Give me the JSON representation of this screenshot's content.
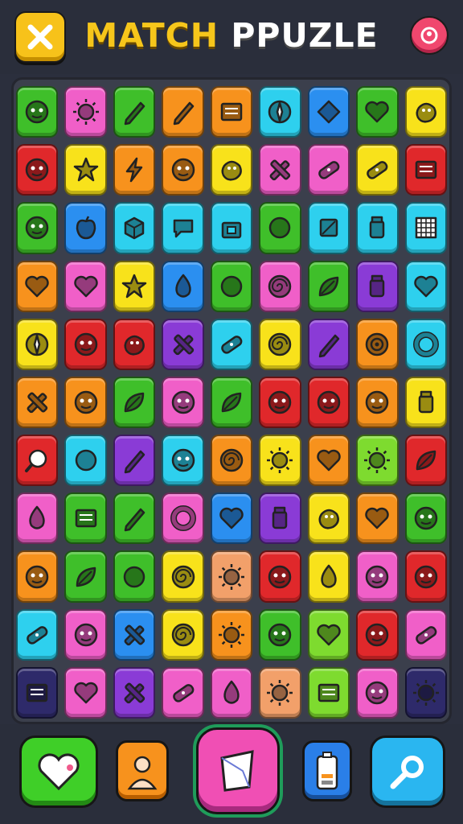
{
  "header": {
    "title_part1": "MATCH",
    "title_part2": "PPUZLE",
    "close_icon": "close-x-icon",
    "profile_icon": "profile-icon"
  },
  "colors": {
    "green": "#3fbf2a",
    "pink": "#f05fc8",
    "orange": "#f7921d",
    "cyan": "#2ed0ee",
    "blue": "#2b8ff0",
    "yellow": "#f8e21b",
    "red": "#e0282b",
    "purple": "#8a3bd6",
    "navy": "#2e2a6a",
    "peach": "#f2a06a",
    "lime": "#7edb2f"
  },
  "board": {
    "rows": [
      [
        {
          "c": "green",
          "i": "face"
        },
        {
          "c": "pink",
          "i": "sun"
        },
        {
          "c": "green",
          "i": "pencil"
        },
        {
          "c": "orange",
          "i": "pencil"
        },
        {
          "c": "orange",
          "i": "book"
        },
        {
          "c": "cyan",
          "i": "compass"
        },
        {
          "c": "blue",
          "i": "diamond"
        },
        {
          "c": "green",
          "i": "heart"
        },
        {
          "c": "yellow",
          "i": "blob"
        }
      ],
      [
        {
          "c": "red",
          "i": "face"
        },
        {
          "c": "yellow",
          "i": "star"
        },
        {
          "c": "orange",
          "i": "bolt"
        },
        {
          "c": "orange",
          "i": "face"
        },
        {
          "c": "yellow",
          "i": "blob"
        },
        {
          "c": "pink",
          "i": "cross"
        },
        {
          "c": "pink",
          "i": "bandage"
        },
        {
          "c": "yellow",
          "i": "bandage"
        },
        {
          "c": "red",
          "i": "book"
        }
      ],
      [
        {
          "c": "green",
          "i": "face"
        },
        {
          "c": "blue",
          "i": "apple"
        },
        {
          "c": "cyan",
          "i": "cube"
        },
        {
          "c": "cyan",
          "i": "note"
        },
        {
          "c": "cyan",
          "i": "gift"
        },
        {
          "c": "green",
          "i": "circle"
        },
        {
          "c": "cyan",
          "i": "square"
        },
        {
          "c": "cyan",
          "i": "jar"
        },
        {
          "c": "cyan",
          "i": "grid"
        }
      ],
      [
        {
          "c": "orange",
          "i": "heart"
        },
        {
          "c": "pink",
          "i": "heart"
        },
        {
          "c": "yellow",
          "i": "star"
        },
        {
          "c": "blue",
          "i": "drop"
        },
        {
          "c": "green",
          "i": "circle"
        },
        {
          "c": "pink",
          "i": "swirl"
        },
        {
          "c": "green",
          "i": "leaf"
        },
        {
          "c": "purple",
          "i": "jar"
        },
        {
          "c": "cyan",
          "i": "heart"
        }
      ],
      [
        {
          "c": "yellow",
          "i": "compass"
        },
        {
          "c": "red",
          "i": "face"
        },
        {
          "c": "red",
          "i": "blob"
        },
        {
          "c": "purple",
          "i": "cross"
        },
        {
          "c": "cyan",
          "i": "bandage"
        },
        {
          "c": "yellow",
          "i": "swirl"
        },
        {
          "c": "purple",
          "i": "pencil"
        },
        {
          "c": "orange",
          "i": "target"
        },
        {
          "c": "cyan",
          "i": "ring"
        }
      ],
      [
        {
          "c": "orange",
          "i": "cross"
        },
        {
          "c": "orange",
          "i": "face"
        },
        {
          "c": "green",
          "i": "leaf"
        },
        {
          "c": "pink",
          "i": "face"
        },
        {
          "c": "green",
          "i": "leaf"
        },
        {
          "c": "red",
          "i": "face"
        },
        {
          "c": "red",
          "i": "face"
        },
        {
          "c": "orange",
          "i": "face"
        },
        {
          "c": "yellow",
          "i": "jar"
        }
      ],
      [
        {
          "c": "red",
          "i": "search"
        },
        {
          "c": "cyan",
          "i": "circle"
        },
        {
          "c": "purple",
          "i": "pencil"
        },
        {
          "c": "cyan",
          "i": "face"
        },
        {
          "c": "orange",
          "i": "swirl"
        },
        {
          "c": "yellow",
          "i": "sun"
        },
        {
          "c": "orange",
          "i": "heart"
        },
        {
          "c": "lime",
          "i": "sun"
        },
        {
          "c": "red",
          "i": "leaf"
        }
      ],
      [
        {
          "c": "pink",
          "i": "drop"
        },
        {
          "c": "green",
          "i": "book"
        },
        {
          "c": "green",
          "i": "pencil"
        },
        {
          "c": "pink",
          "i": "ring"
        },
        {
          "c": "blue",
          "i": "heart"
        },
        {
          "c": "purple",
          "i": "jar"
        },
        {
          "c": "yellow",
          "i": "blob"
        },
        {
          "c": "orange",
          "i": "heart"
        },
        {
          "c": "green",
          "i": "face"
        }
      ],
      [
        {
          "c": "orange",
          "i": "face"
        },
        {
          "c": "green",
          "i": "leaf"
        },
        {
          "c": "green",
          "i": "circle"
        },
        {
          "c": "yellow",
          "i": "swirl"
        },
        {
          "c": "peach",
          "i": "sun"
        },
        {
          "c": "red",
          "i": "face"
        },
        {
          "c": "yellow",
          "i": "drop"
        },
        {
          "c": "pink",
          "i": "face"
        },
        {
          "c": "red",
          "i": "face"
        }
      ],
      [
        {
          "c": "cyan",
          "i": "bandage"
        },
        {
          "c": "pink",
          "i": "face"
        },
        {
          "c": "blue",
          "i": "cross"
        },
        {
          "c": "yellow",
          "i": "swirl"
        },
        {
          "c": "orange",
          "i": "sun"
        },
        {
          "c": "green",
          "i": "face"
        },
        {
          "c": "lime",
          "i": "heart"
        },
        {
          "c": "red",
          "i": "face"
        },
        {
          "c": "pink",
          "i": "bandage"
        }
      ],
      [
        {
          "c": "navy",
          "i": "book"
        },
        {
          "c": "pink",
          "i": "heart"
        },
        {
          "c": "purple",
          "i": "cross"
        },
        {
          "c": "pink",
          "i": "bandage"
        },
        {
          "c": "pink",
          "i": "drop"
        },
        {
          "c": "peach",
          "i": "sun"
        },
        {
          "c": "lime",
          "i": "book"
        },
        {
          "c": "pink",
          "i": "face"
        },
        {
          "c": "navy",
          "i": "sun"
        }
      ]
    ]
  },
  "footer": {
    "buttons": [
      {
        "name": "lives-button",
        "icon": "heart-icon",
        "color": "#3fcf28"
      },
      {
        "name": "avatar-button",
        "icon": "person-icon",
        "color": "#f7921d"
      },
      {
        "name": "play-card-button",
        "icon": "card-icon",
        "color": "#f04fb4"
      },
      {
        "name": "battery-button",
        "icon": "battery-icon",
        "color": "#2a7fe8"
      },
      {
        "name": "settings-button",
        "icon": "wrench-icon",
        "color": "#2ab6f0"
      }
    ]
  }
}
